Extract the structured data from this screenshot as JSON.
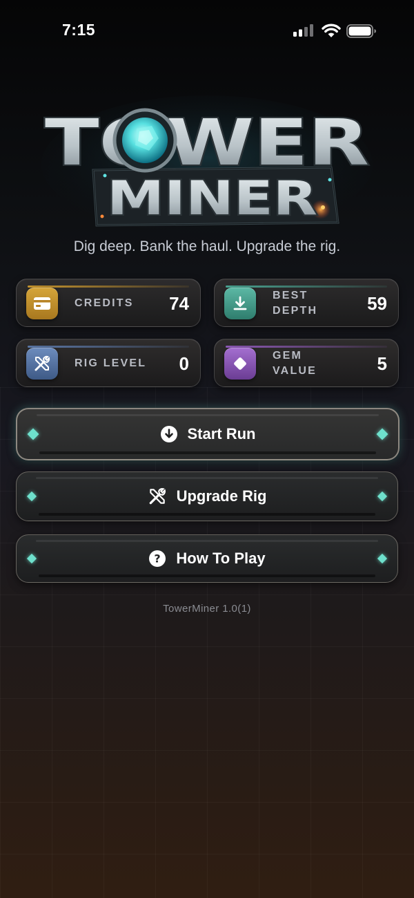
{
  "status_bar": {
    "time": "7:15"
  },
  "logo": {
    "line1": "TOWER",
    "line2": "MINER"
  },
  "tagline": "Dig deep. Bank the haul. Upgrade the rig.",
  "stats": {
    "credits": {
      "label": "CREDITS",
      "value": "74",
      "icon": "credit-card-icon",
      "color": "#c9962e"
    },
    "best_depth": {
      "label_line1": "BEST",
      "label_line2": "DEPTH",
      "value": "59",
      "icon": "download-icon",
      "color": "#4aa593"
    },
    "rig_level": {
      "label": "RIG LEVEL",
      "value": "0",
      "icon": "tools-icon",
      "color": "#5b78a8"
    },
    "gem_value": {
      "label_line1": "GEM",
      "label_line2": "VALUE",
      "value": "5",
      "icon": "diamond-icon",
      "color": "#8e5ab8"
    }
  },
  "menu": {
    "start_run": {
      "label": "Start Run",
      "icon": "arrow-down-circle-icon"
    },
    "upgrade_rig": {
      "label": "Upgrade Rig",
      "icon": "tools-icon"
    },
    "how_to_play": {
      "label": "How To Play",
      "icon": "question-circle-icon"
    }
  },
  "version": "TowerMiner 1.0(1)",
  "colors": {
    "accent_teal": "#6ee0cc",
    "gold": "#c9962e"
  }
}
